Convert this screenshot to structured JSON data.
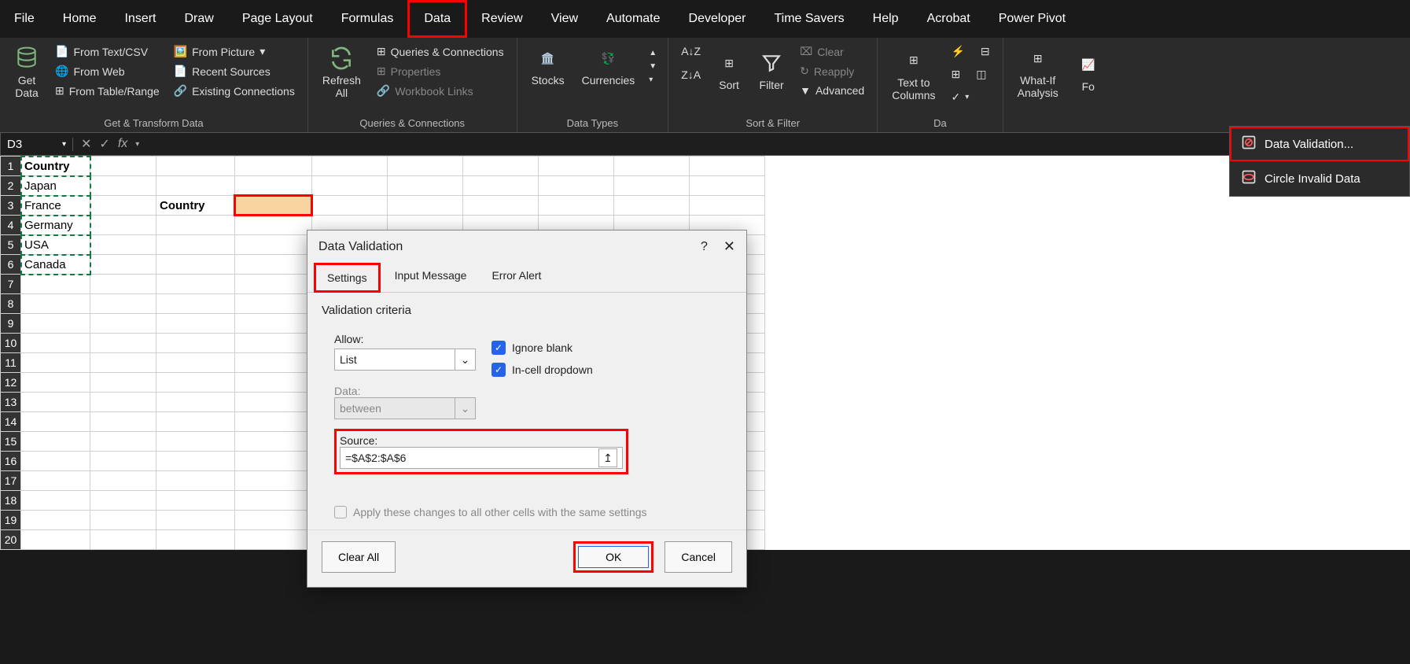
{
  "ribbon_tabs": [
    "File",
    "Home",
    "Insert",
    "Draw",
    "Page Layout",
    "Formulas",
    "Data",
    "Review",
    "View",
    "Automate",
    "Developer",
    "Time Savers",
    "Help",
    "Acrobat",
    "Power Pivot"
  ],
  "active_tab_index": 6,
  "name_box": "D3",
  "formula": "",
  "ribbon": {
    "get_data": "Get\nData",
    "g1_items": [
      "From Text/CSV",
      "From Web",
      "From Table/Range",
      "From Picture",
      "Recent Sources",
      "Existing Connections"
    ],
    "g1_title": "Get & Transform Data",
    "refresh_all": "Refresh\nAll",
    "g2_items": [
      "Queries & Connections",
      "Properties",
      "Workbook Links"
    ],
    "g2_title": "Queries & Connections",
    "stocks": "Stocks",
    "currencies": "Currencies",
    "g3_title": "Data Types",
    "sort": "Sort",
    "filter": "Filter",
    "clear": "Clear",
    "reapply": "Reapply",
    "advanced": "Advanced",
    "g4_title": "Sort & Filter",
    "text_to_cols": "Text to\nColumns",
    "g5_title": "Da",
    "whatif": "What-If\nAnalysis",
    "fo": "Fo"
  },
  "dropdown": {
    "dv": "Data Validation...",
    "circle": "Circle Invalid Data"
  },
  "sheet": {
    "rows": [
      {
        "n": 1,
        "A": "Country"
      },
      {
        "n": 2,
        "A": "Japan"
      },
      {
        "n": 3,
        "A": "France",
        "C": "Country"
      },
      {
        "n": 4,
        "A": "Germany"
      },
      {
        "n": 5,
        "A": "USA"
      },
      {
        "n": 6,
        "A": "Canada"
      }
    ],
    "extra_rows": [
      7,
      8,
      9,
      10,
      11,
      12,
      13,
      14,
      15,
      16,
      17,
      18,
      19,
      20
    ]
  },
  "dialog": {
    "title": "Data Validation",
    "help": "?",
    "tabs": [
      "Settings",
      "Input Message",
      "Error Alert"
    ],
    "active_tab": 0,
    "body": {
      "section": "Validation criteria",
      "allow_label": "Allow:",
      "allow_value": "List",
      "data_label": "Data:",
      "data_value": "between",
      "ignore_blank": "Ignore blank",
      "incell": "In-cell dropdown",
      "source_label": "Source:",
      "source_value": "=$A$2:$A$6",
      "apply_all": "Apply these changes to all other cells with the same settings"
    },
    "footer": {
      "clear": "Clear All",
      "ok": "OK",
      "cancel": "Cancel"
    }
  }
}
